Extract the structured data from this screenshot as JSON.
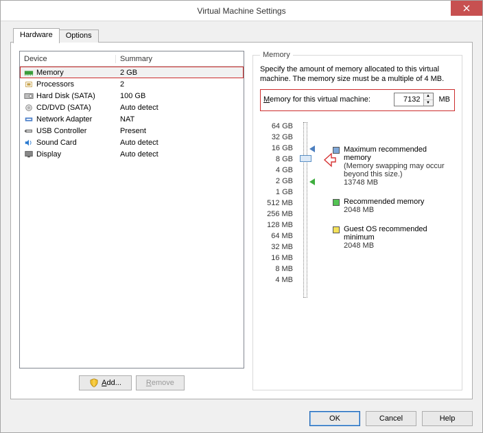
{
  "title": "Virtual Machine Settings",
  "tabs": {
    "hardware": "Hardware",
    "options": "Options"
  },
  "columns": {
    "device": "Device",
    "summary": "Summary"
  },
  "devices": [
    {
      "name": "Memory",
      "summary": "2 GB"
    },
    {
      "name": "Processors",
      "summary": "2"
    },
    {
      "name": "Hard Disk (SATA)",
      "summary": "100 GB"
    },
    {
      "name": "CD/DVD (SATA)",
      "summary": "Auto detect"
    },
    {
      "name": "Network Adapter",
      "summary": "NAT"
    },
    {
      "name": "USB Controller",
      "summary": "Present"
    },
    {
      "name": "Sound Card",
      "summary": "Auto detect"
    },
    {
      "name": "Display",
      "summary": "Auto detect"
    }
  ],
  "buttons": {
    "add": "Add...",
    "remove": "Remove",
    "ok": "OK",
    "cancel": "Cancel",
    "help": "Help"
  },
  "group": {
    "legend": "Memory",
    "intro": "Specify the amount of memory allocated to this virtual machine. The memory size must be a multiple of 4 MB.",
    "label": "Memory for this virtual machine:",
    "value": "7132",
    "unit": "MB"
  },
  "ticks": [
    "64 GB",
    "32 GB",
    "16 GB",
    "8 GB",
    "4 GB",
    "2 GB",
    "1 GB",
    "512 MB",
    "256 MB",
    "128 MB",
    "64 MB",
    "32 MB",
    "16 MB",
    "8 MB",
    "4 MB"
  ],
  "legend": {
    "max": {
      "label": "Maximum recommended memory",
      "note": "(Memory swapping may occur beyond this size.)",
      "val": "13748 MB"
    },
    "rec": {
      "label": "Recommended memory",
      "val": "2048 MB"
    },
    "guest": {
      "label": "Guest OS recommended minimum",
      "val": "2048 MB"
    }
  },
  "icon_colors": {
    "memory": "#3a9c3a",
    "proc": "#c7a24a",
    "hdd": "#6a6a6a",
    "cd": "#888",
    "net": "#4b7fc9",
    "usb": "#555",
    "sound": "#2a7ad0",
    "display": "#666",
    "shield": "#f4c430"
  }
}
